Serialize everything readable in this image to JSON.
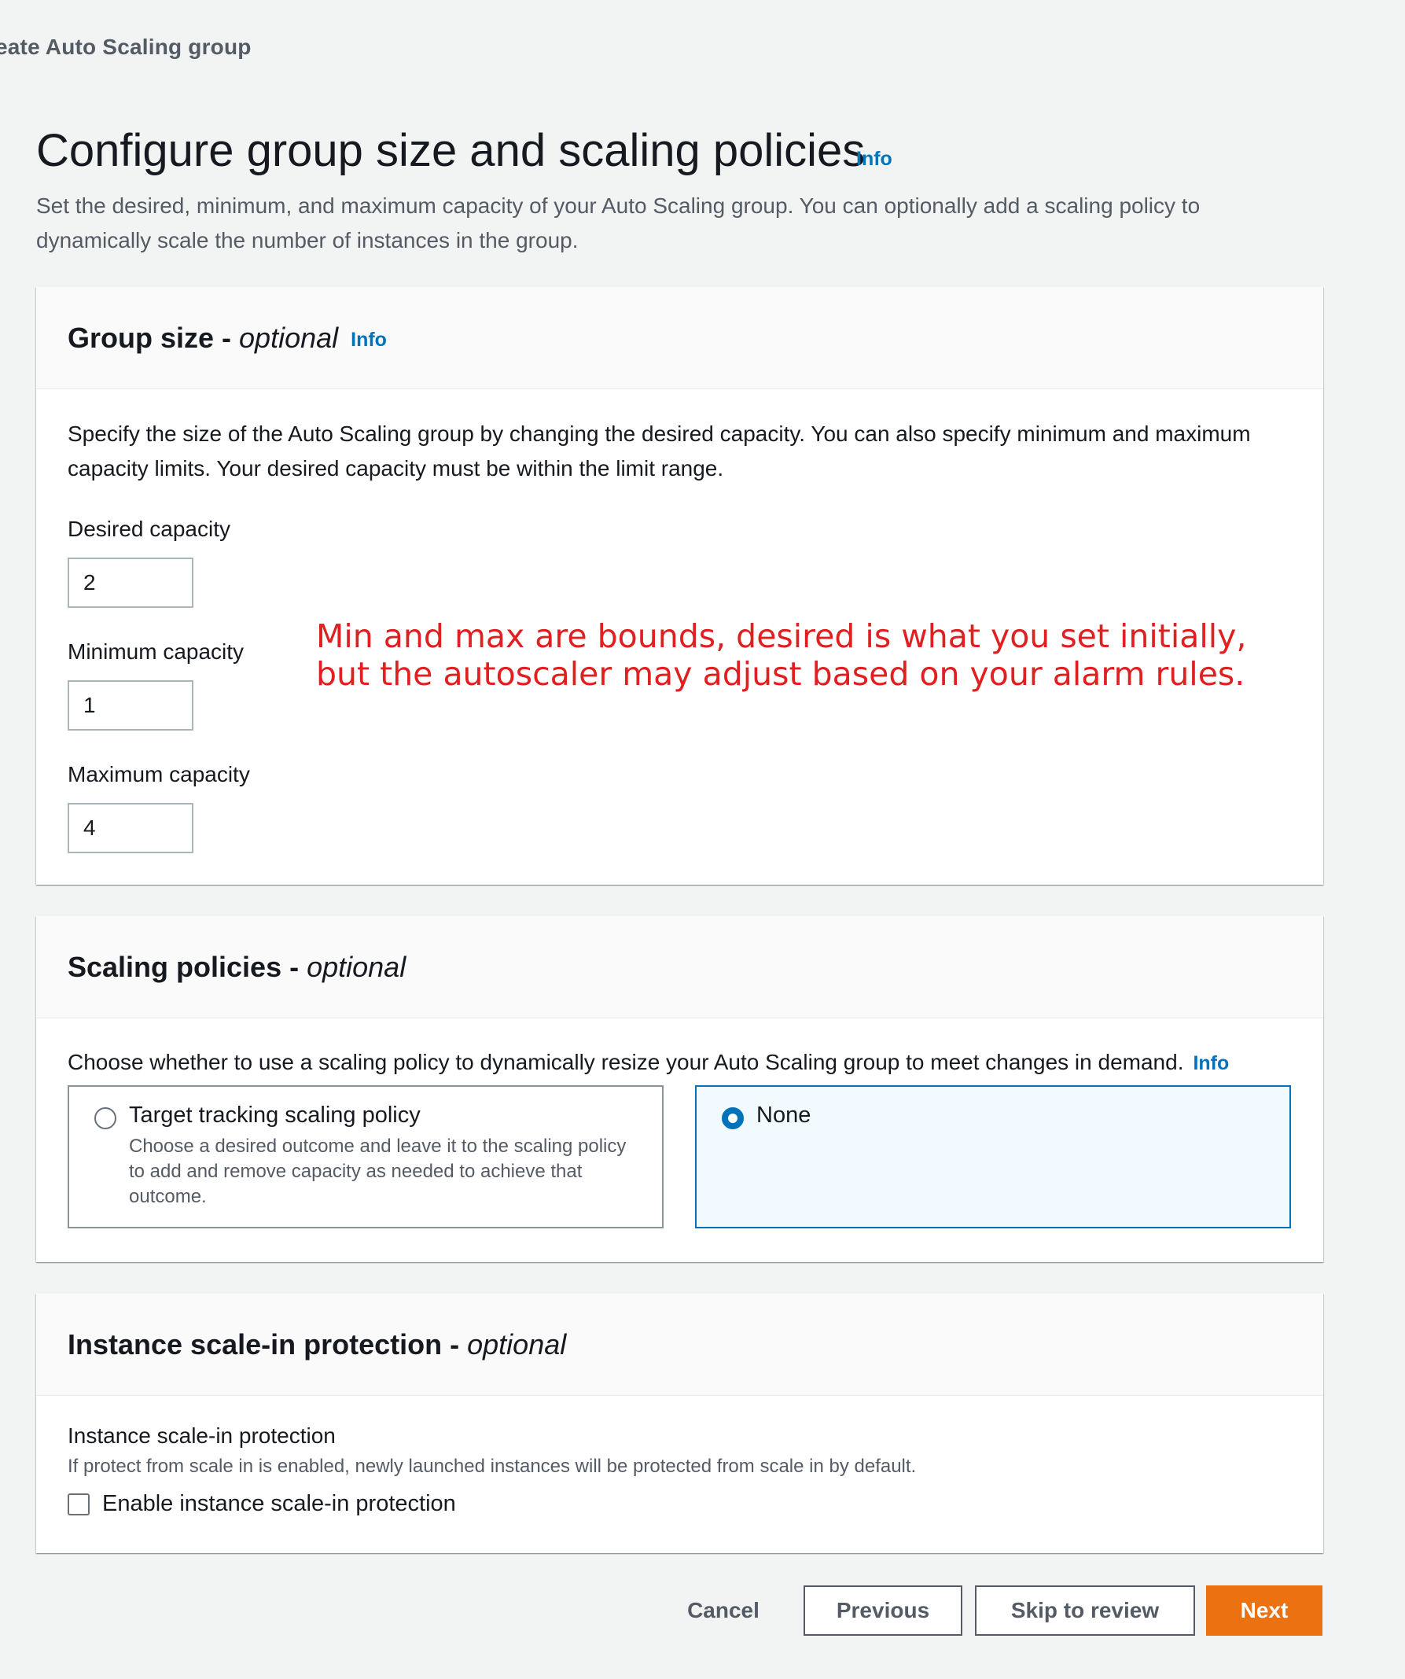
{
  "breadcrumb": "eate Auto Scaling group",
  "page": {
    "title": "Configure group size and scaling policies",
    "info": "Info",
    "description": "Set the desired, minimum, and maximum capacity of your Auto Scaling group. You can optionally add a scaling policy to dynamically scale the number of instances in the group."
  },
  "group_size": {
    "title": "Group size",
    "optional": "optional",
    "separator": " - ",
    "info": "Info",
    "description": "Specify the size of the Auto Scaling group by changing the desired capacity. You can also specify minimum and maximum capacity limits. Your desired capacity must be within the limit range.",
    "desired_label": "Desired capacity",
    "desired_value": "2",
    "min_label": "Minimum capacity",
    "min_value": "1",
    "max_label": "Maximum capacity",
    "max_value": "4"
  },
  "annotation": {
    "line1": "Min and max are bounds, desired is what you set initially,",
    "line2": "but the autoscaler may adjust based on your alarm rules."
  },
  "scaling_policies": {
    "title": "Scaling policies",
    "optional": "optional",
    "separator": " - ",
    "description": "Choose whether to use a scaling policy to dynamically resize your Auto Scaling group to meet changes in demand.",
    "info": "Info",
    "options": [
      {
        "label": "Target tracking scaling policy",
        "description": "Choose a desired outcome and leave it to the scaling policy to add and remove capacity as needed to achieve that outcome.",
        "selected": false
      },
      {
        "label": "None",
        "description": "",
        "selected": true
      }
    ]
  },
  "scale_in": {
    "title": "Instance scale-in protection",
    "optional": "optional",
    "separator": " - ",
    "label": "Instance scale-in protection",
    "description": "If protect from scale in is enabled, newly launched instances will be protected from scale in by default.",
    "checkbox_label": "Enable instance scale-in protection",
    "checked": false
  },
  "footer": {
    "cancel": "Cancel",
    "previous": "Previous",
    "skip": "Skip to review",
    "next": "Next"
  },
  "colors": {
    "accent": "#0073bb",
    "primary_button": "#ec7211",
    "annotation": "#e02020",
    "background": "#f2f3f3"
  }
}
